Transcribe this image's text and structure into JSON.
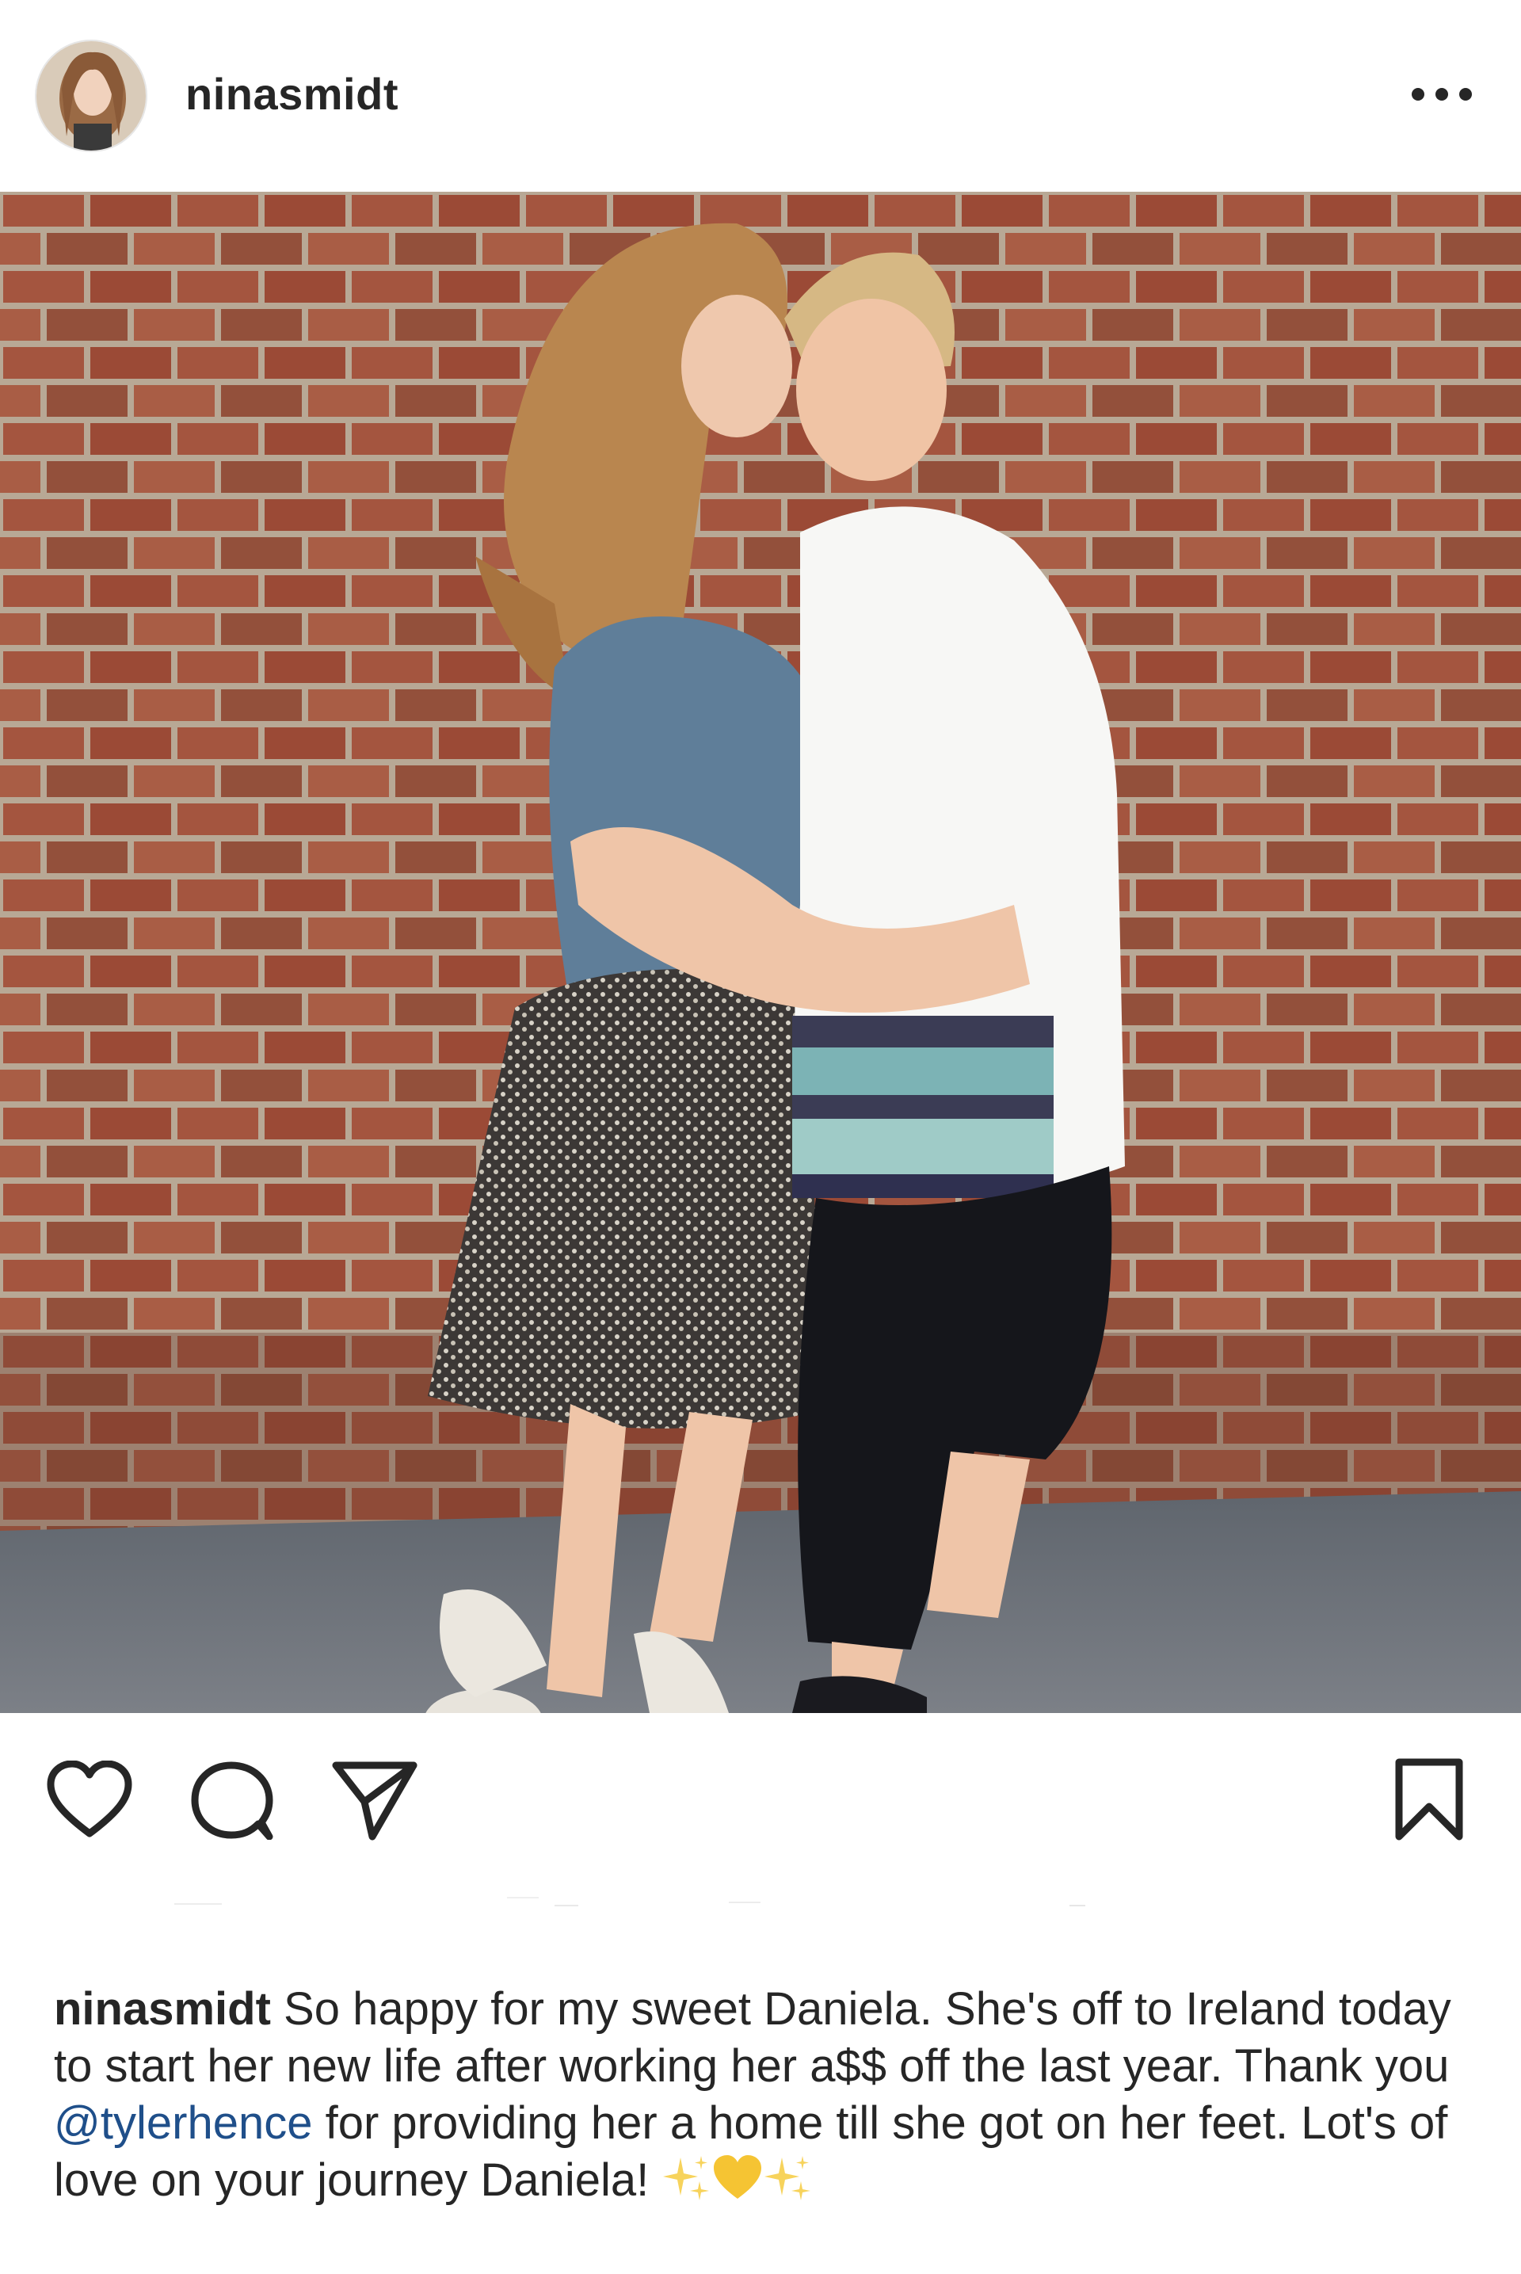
{
  "post": {
    "username": "ninasmidt"
  },
  "icons": {
    "avatar": "profile-photo",
    "more": "more-options-icon",
    "like": "heart-icon",
    "comment": "comment-bubble-icon",
    "share": "paper-plane-icon",
    "save": "bookmark-icon"
  },
  "photo": {
    "subject": "two women hugging in front of a brick wall"
  },
  "caption": {
    "username": "ninasmidt",
    "text_part1": " So happy for my sweet Daniela. She's off to Ireland today to start her new life after working her a$$ off the last year. Thank you ",
    "mention": "@tylerhence",
    "text_part2": " for providing her a home till she got on her feet. Lot's of love on your journey Daniela! ",
    "emojis": [
      "sparkles",
      "yellow-heart",
      "sparkles"
    ]
  },
  "colors": {
    "text": "#262626",
    "mention": "#1f4f8a",
    "brick": "#a0523d",
    "mortar": "#c9b8a6",
    "pavement": "#6e7278"
  }
}
